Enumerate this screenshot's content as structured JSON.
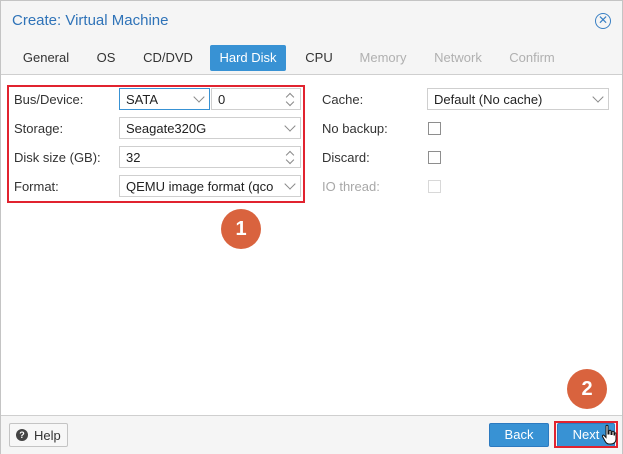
{
  "window": {
    "title": "Create: Virtual Machine"
  },
  "tabs": [
    {
      "label": "General",
      "state": "normal"
    },
    {
      "label": "OS",
      "state": "normal"
    },
    {
      "label": "CD/DVD",
      "state": "normal"
    },
    {
      "label": "Hard Disk",
      "state": "active"
    },
    {
      "label": "CPU",
      "state": "normal"
    },
    {
      "label": "Memory",
      "state": "disabled"
    },
    {
      "label": "Network",
      "state": "disabled"
    },
    {
      "label": "Confirm",
      "state": "disabled"
    }
  ],
  "left": {
    "bus_label": "Bus/Device:",
    "bus_value": "SATA",
    "device_value": "0",
    "storage_label": "Storage:",
    "storage_value": "Seagate320G",
    "disk_size_label": "Disk size (GB):",
    "disk_size_value": "32",
    "format_label": "Format:",
    "format_value": "QEMU image format (qco"
  },
  "right": {
    "cache_label": "Cache:",
    "cache_value": "Default (No cache)",
    "no_backup_label": "No backup:",
    "no_backup_checked": false,
    "discard_label": "Discard:",
    "discard_checked": false,
    "io_thread_label": "IO thread:",
    "io_thread_checked": false
  },
  "annotations": {
    "badge_1": "1",
    "badge_2": "2"
  },
  "footer": {
    "help_label": "Help",
    "back_label": "Back",
    "next_label": "Next"
  },
  "colors": {
    "accent": "#3892d4",
    "title": "#2f73b8",
    "highlight": "#e1232f",
    "badge": "#d9633e"
  }
}
